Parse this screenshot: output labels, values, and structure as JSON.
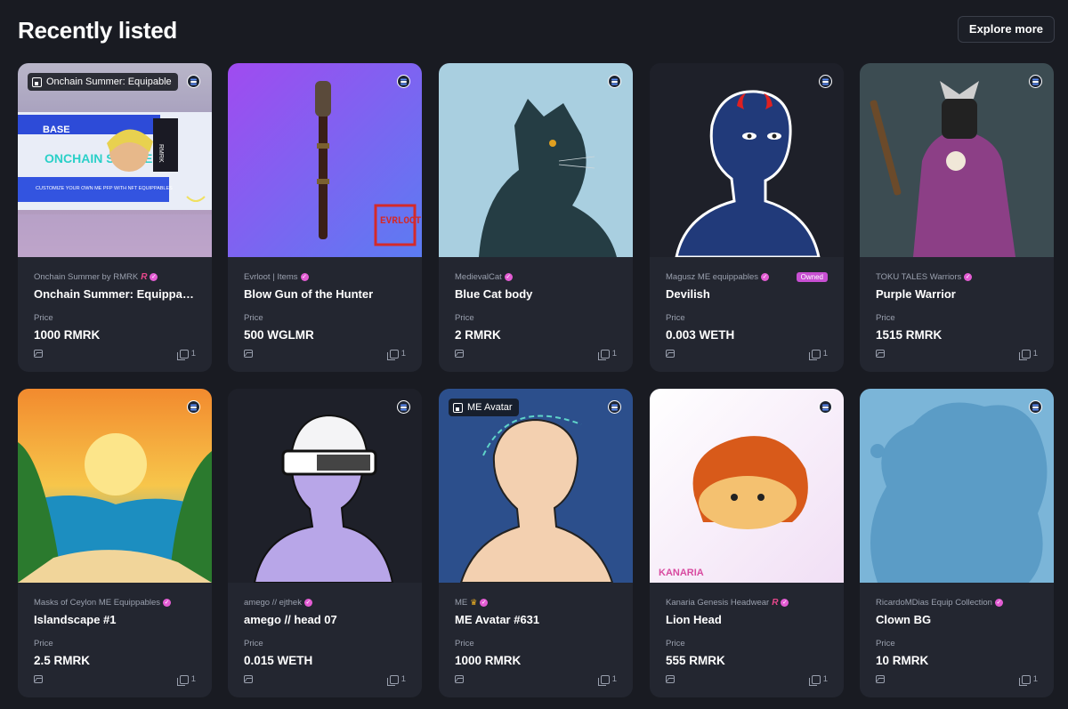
{
  "page": {
    "title": "Recently listed",
    "explore_label": "Explore more"
  },
  "cards": [
    {
      "collection": "Onchain Summer by RMRK",
      "name": "Onchain Summer: Equippable...",
      "price_label": "Price",
      "price": "1000 RMRK",
      "copies": "1",
      "tag": "Onchain Summer: Equipable",
      "art_text": [
        "BASE",
        "ONCHAIN SUMMER",
        "CUSTOMIZE YOUR OWN ME PFP WITH NFT EQUIPPABLES",
        "RMRK"
      ]
    },
    {
      "collection": "Evrloot | Items",
      "name": "Blow Gun of the Hunter",
      "price_label": "Price",
      "price": "500 WGLMR",
      "copies": "1",
      "art_text": [
        "EVRLOOT"
      ]
    },
    {
      "collection": "MedievalCat",
      "name": "Blue Cat body",
      "price_label": "Price",
      "price": "2 RMRK",
      "copies": "1"
    },
    {
      "collection": "Magusz ME equippables",
      "name": "Devilish",
      "price_label": "Price",
      "price": "0.003 WETH",
      "copies": "1",
      "badge": "Owned"
    },
    {
      "collection": "TOKU TALES Warriors",
      "name": "Purple Warrior",
      "price_label": "Price",
      "price": "1515 RMRK",
      "copies": "1"
    },
    {
      "collection": "Masks of Ceylon ME Equippables",
      "name": "Islandscape #1",
      "price_label": "Price",
      "price": "2.5 RMRK",
      "copies": "1"
    },
    {
      "collection": "amego // ejthek",
      "name": "amego // head 07",
      "price_label": "Price",
      "price": "0.015 WETH",
      "copies": "1"
    },
    {
      "collection": "ME",
      "name": "ME Avatar #631",
      "price_label": "Price",
      "price": "1000 RMRK",
      "copies": "1",
      "tag": "ME Avatar"
    },
    {
      "collection": "Kanaria Genesis Headwear",
      "name": "Lion Head",
      "price_label": "Price",
      "price": "555 RMRK",
      "copies": "1",
      "art_text": [
        "KANARIA"
      ]
    },
    {
      "collection": "RicardoMDias Equip Collection",
      "name": "Clown BG",
      "price_label": "Price",
      "price": "10 RMRK",
      "copies": "1"
    }
  ],
  "colors": {
    "background": "#191b22",
    "card": "#232630",
    "muted": "#9aa0ae",
    "verified": "#e35cd3",
    "rmrk": "#e8478c",
    "owned": "#c84fd3"
  }
}
